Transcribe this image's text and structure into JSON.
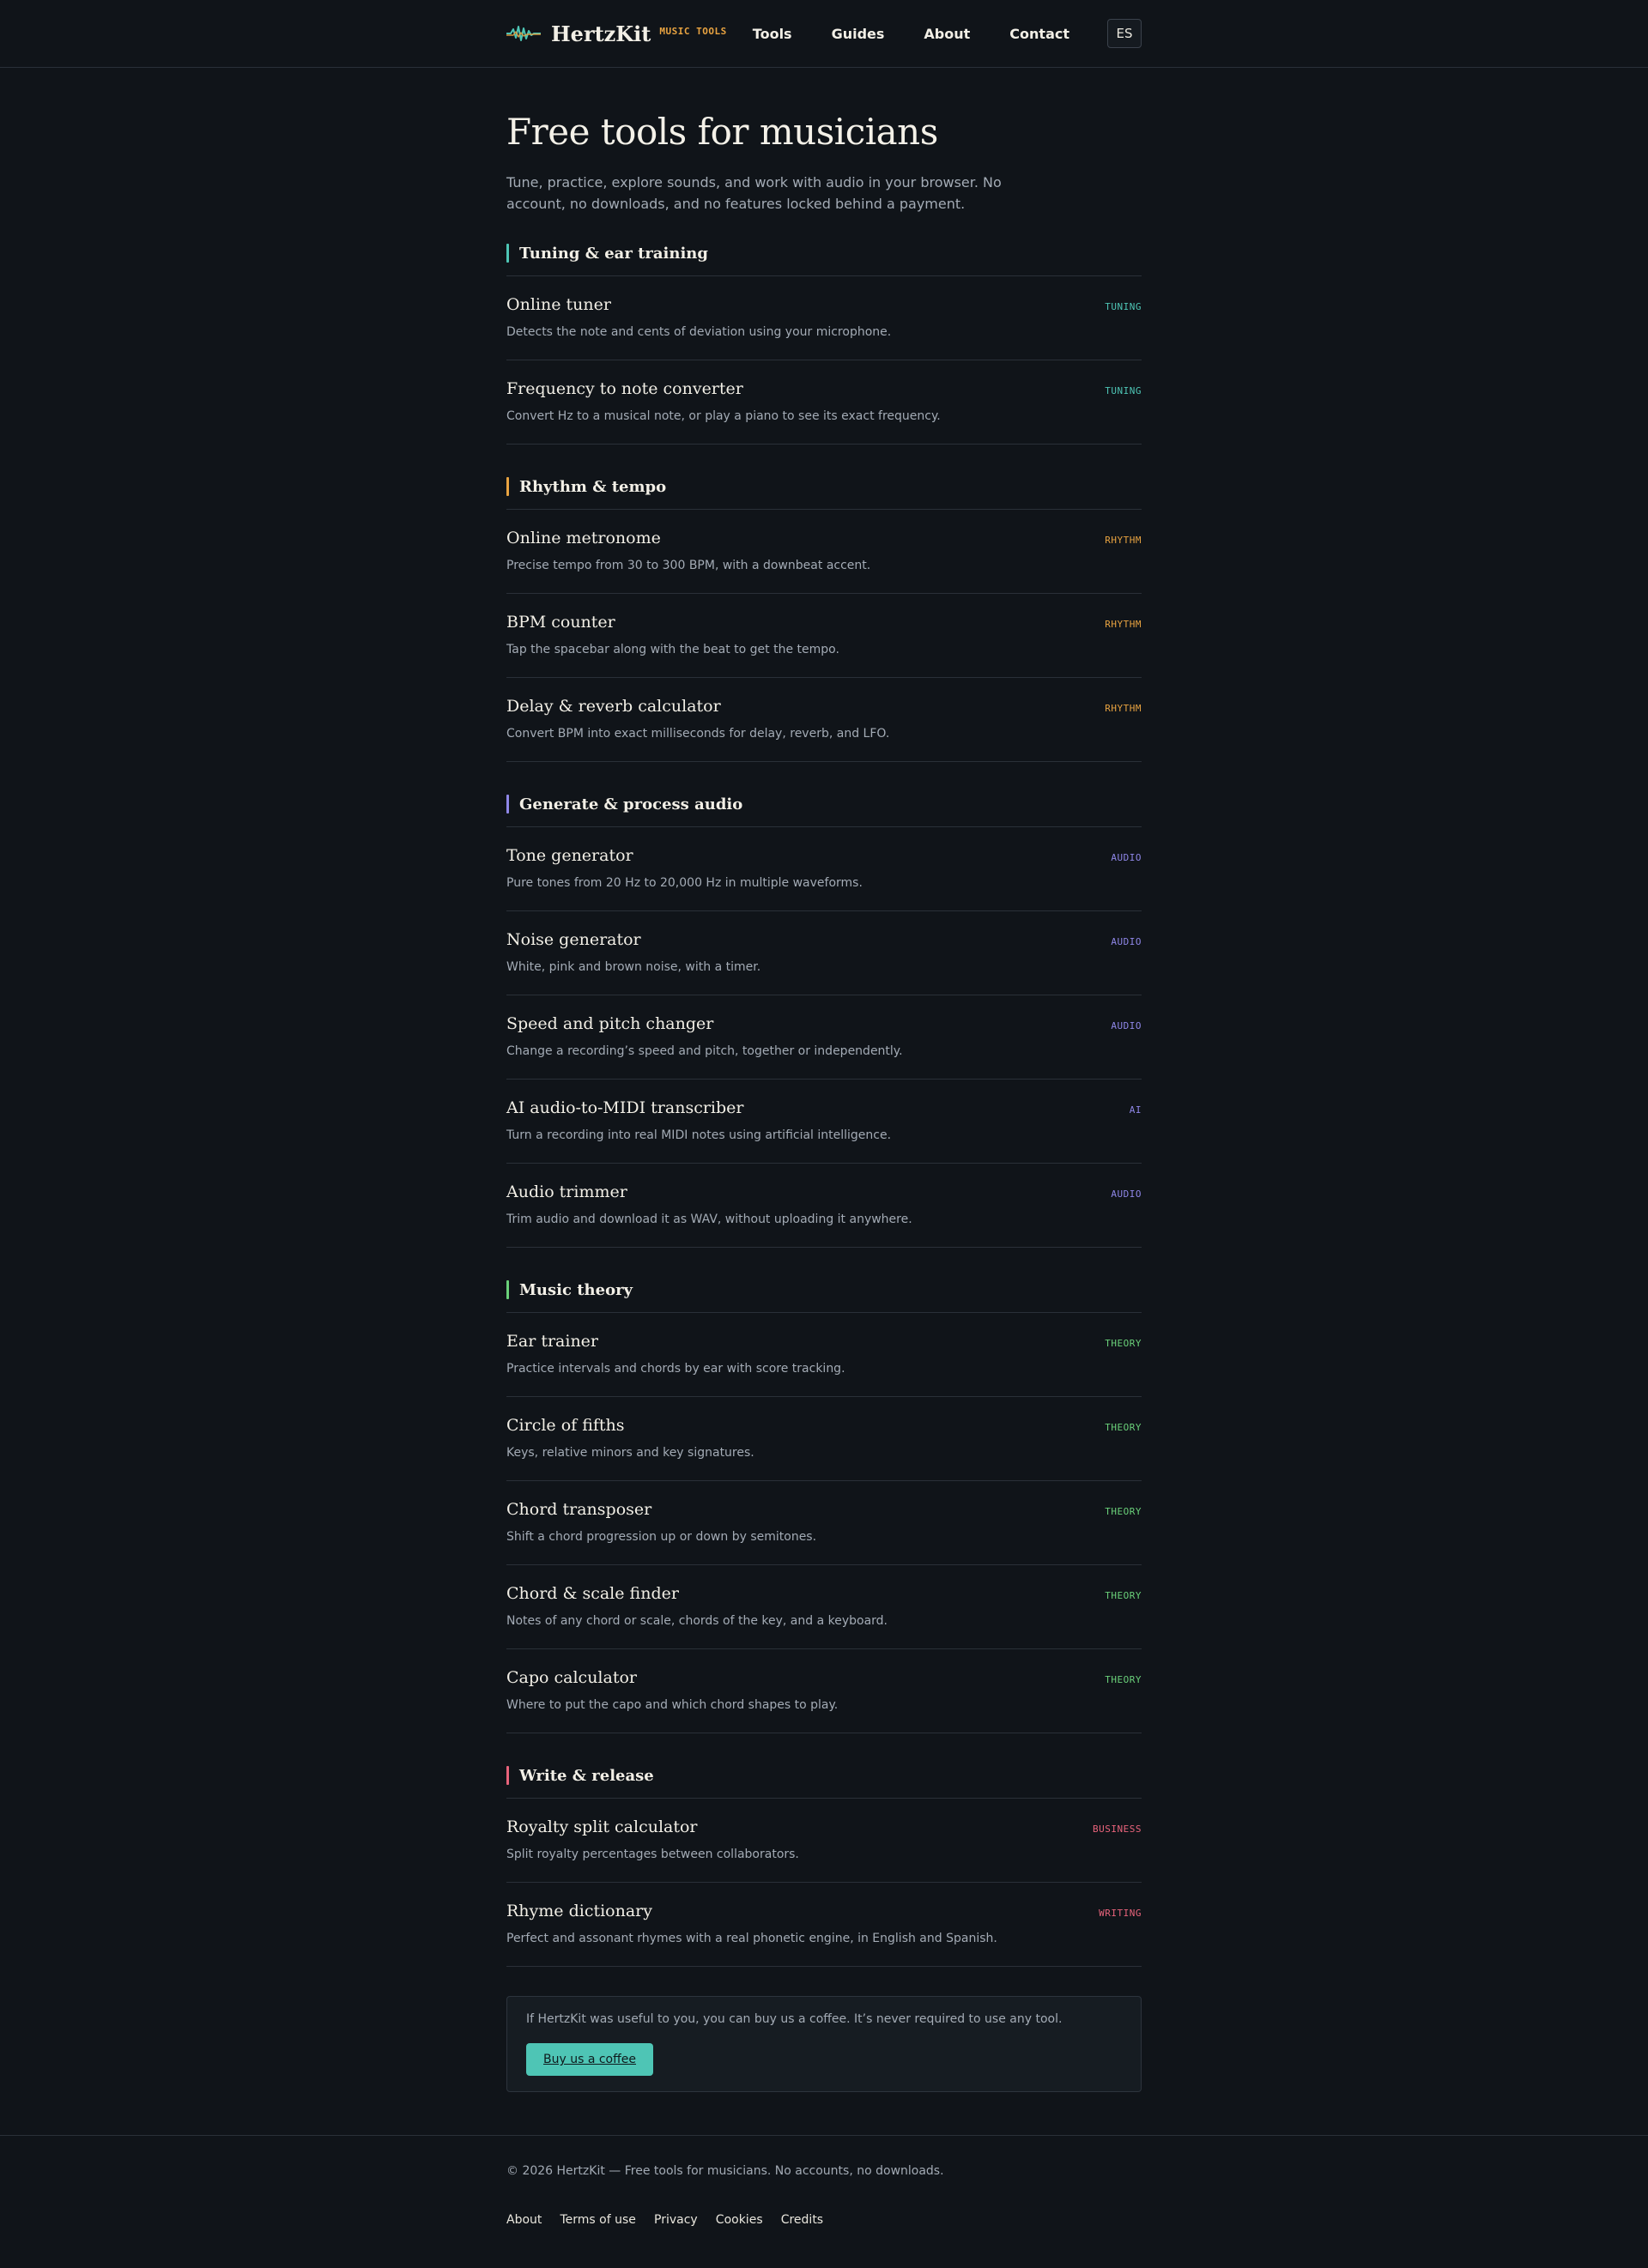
{
  "header": {
    "logo_name": "HertzKit",
    "logo_tag": "MUSIC TOOLS",
    "nav": [
      "Tools",
      "Guides",
      "About",
      "Contact"
    ],
    "lang": "ES"
  },
  "intro": {
    "title": "Free tools for musicians",
    "text": "Tune, practice, explore sounds, and work with audio in your browser. No account, no downloads, and no features locked behind a payment."
  },
  "colors": {
    "tuning": "#4ec5b5",
    "rhythm": "#e8a341",
    "audio": "#8f87e8",
    "theory": "#6ad17a",
    "write": "#e8637b",
    "background": "#101419"
  },
  "sections": [
    {
      "title": "Tuning & ear training",
      "color": "#4ec5b5",
      "tools": [
        {
          "name": "Online tuner",
          "tag": "TUNING",
          "desc": "Detects the note and cents of deviation using your microphone."
        },
        {
          "name": "Frequency to note converter",
          "tag": "TUNING",
          "desc": "Convert Hz to a musical note, or play a piano to see its exact frequency."
        }
      ]
    },
    {
      "title": "Rhythm & tempo",
      "color": "#e8a341",
      "tools": [
        {
          "name": "Online metronome",
          "tag": "RHYTHM",
          "desc": "Precise tempo from 30 to 300 BPM, with a downbeat accent."
        },
        {
          "name": "BPM counter",
          "tag": "RHYTHM",
          "desc": "Tap the spacebar along with the beat to get the tempo."
        },
        {
          "name": "Delay & reverb calculator",
          "tag": "RHYTHM",
          "desc": "Convert BPM into exact milliseconds for delay, reverb, and LFO."
        }
      ]
    },
    {
      "title": "Generate & process audio",
      "color": "#8f87e8",
      "tools": [
        {
          "name": "Tone generator",
          "tag": "AUDIO",
          "desc": "Pure tones from 20 Hz to 20,000 Hz in multiple waveforms."
        },
        {
          "name": "Noise generator",
          "tag": "AUDIO",
          "desc": "White, pink and brown noise, with a timer."
        },
        {
          "name": "Speed and pitch changer",
          "tag": "AUDIO",
          "desc": "Change a recording’s speed and pitch, together or independently."
        },
        {
          "name": "AI audio-to-MIDI transcriber",
          "tag": "AI",
          "desc": "Turn a recording into real MIDI notes using artificial intelligence."
        },
        {
          "name": "Audio trimmer",
          "tag": "AUDIO",
          "desc": "Trim audio and download it as WAV, without uploading it anywhere."
        }
      ]
    },
    {
      "title": "Music theory",
      "color": "#6ad17a",
      "tools": [
        {
          "name": "Ear trainer",
          "tag": "THEORY",
          "desc": "Practice intervals and chords by ear with score tracking."
        },
        {
          "name": "Circle of fifths",
          "tag": "THEORY",
          "desc": "Keys, relative minors and key signatures."
        },
        {
          "name": "Chord transposer",
          "tag": "THEORY",
          "desc": "Shift a chord progression up or down by semitones."
        },
        {
          "name": "Chord & scale finder",
          "tag": "THEORY",
          "desc": "Notes of any chord or scale, chords of the key, and a keyboard."
        },
        {
          "name": "Capo calculator",
          "tag": "THEORY",
          "desc": "Where to put the capo and which chord shapes to play."
        }
      ]
    },
    {
      "title": "Write & release",
      "color": "#e8637b",
      "tools": [
        {
          "name": "Royalty split calculator",
          "tag": "BUSINESS",
          "desc": "Split royalty percentages between collaborators."
        },
        {
          "name": "Rhyme dictionary",
          "tag": "WRITING",
          "desc": "Perfect and assonant rhymes with a real phonetic engine, in English and Spanish."
        }
      ]
    }
  ],
  "donate": {
    "text": "If HertzKit was useful to you, you can buy us a coffee. It’s never required to use any tool.",
    "button": "Buy us a coffee"
  },
  "footer": {
    "copy": "© 2026 HertzKit — Free tools for musicians. No accounts, no downloads.",
    "links": [
      "About",
      "Terms of use",
      "Privacy",
      "Cookies",
      "Credits"
    ]
  }
}
